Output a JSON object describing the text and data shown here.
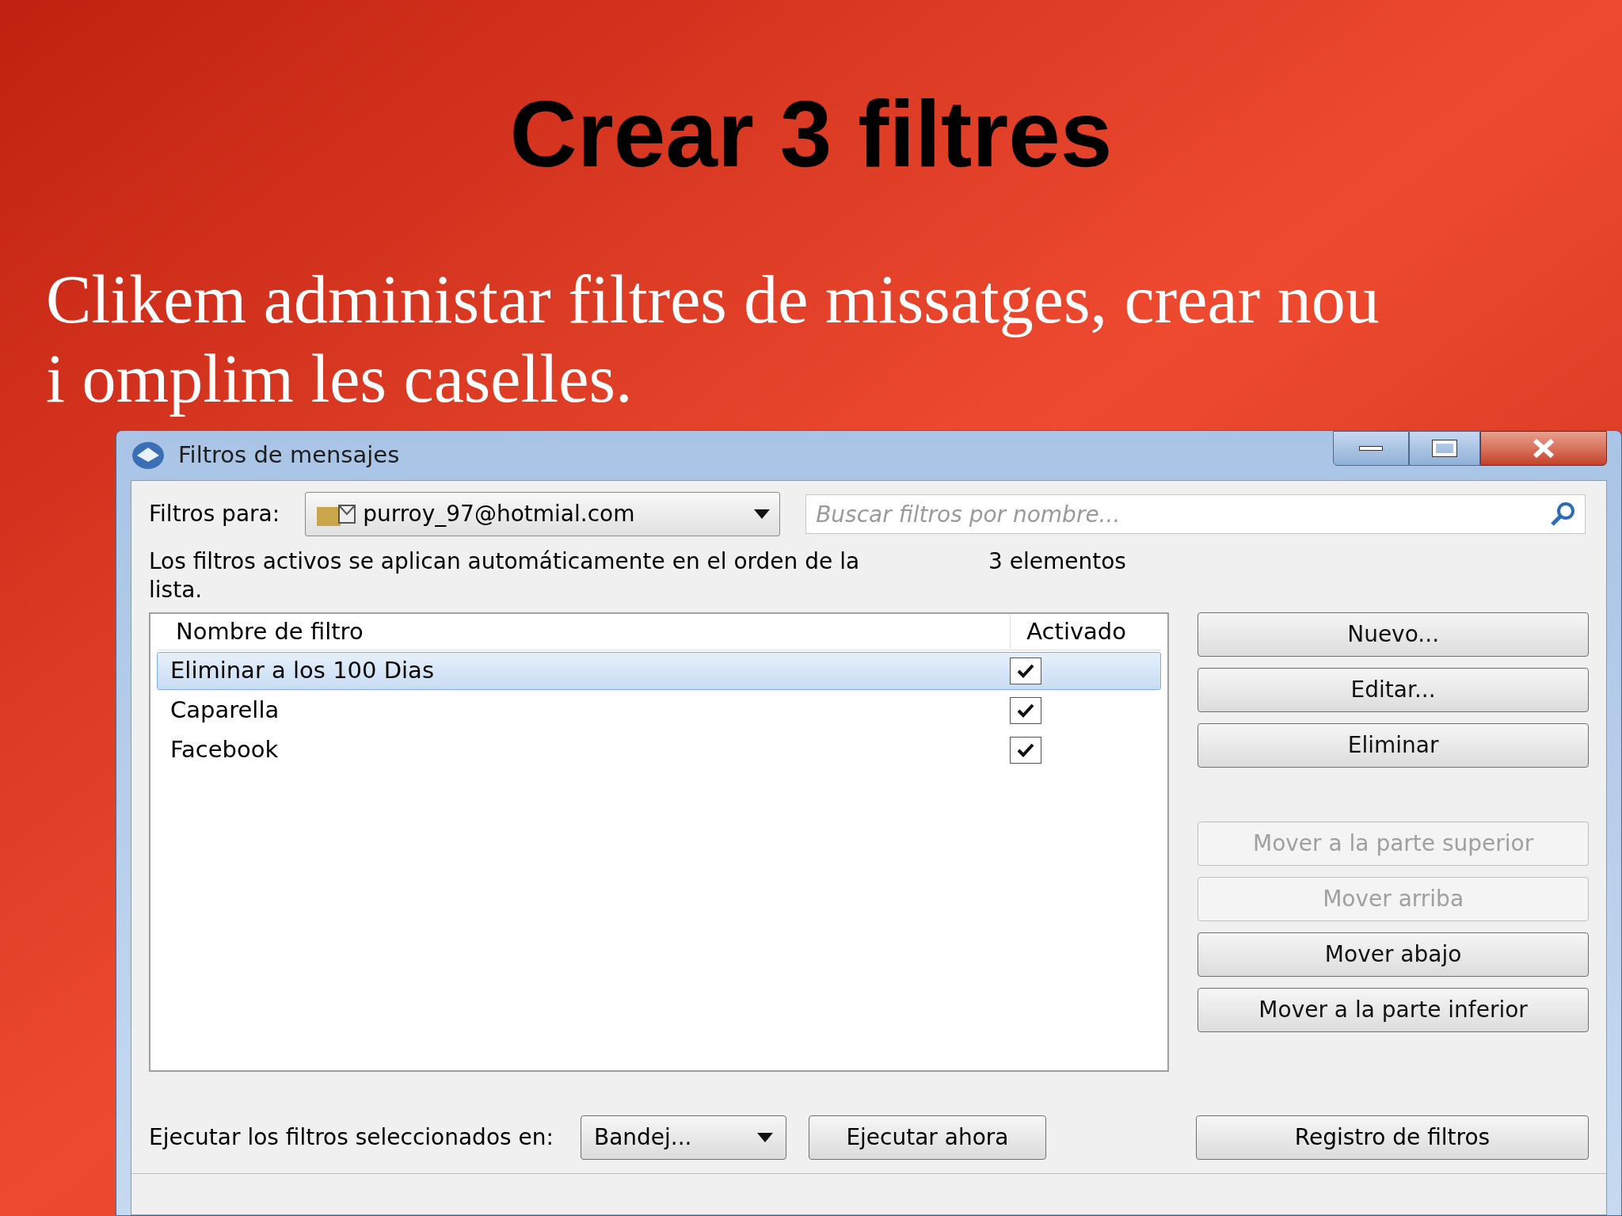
{
  "slide": {
    "title": "Crear 3 filtres",
    "text": "Clikem administar filtres de missatges, crear nou i omplim les caselles."
  },
  "dialog": {
    "title": "Filtros de mensajes",
    "filters_for_label": "Filtros para:",
    "account": "purroy_97@hotmial.com",
    "search": {
      "placeholder": "Buscar filtros por nombre..."
    },
    "description": "Los filtros activos se aplican automáticamente en el orden de la lista.",
    "count": "3 elementos",
    "columns": [
      "Nombre de filtro",
      "Activado"
    ],
    "rows": [
      {
        "name": "Eliminar a los 100 Dias",
        "checked": true,
        "selected": true
      },
      {
        "name": "Caparella",
        "checked": true,
        "selected": false
      },
      {
        "name": "Facebook",
        "checked": true,
        "selected": false
      }
    ],
    "button_groups": [
      [
        {
          "label": "Nuevo...",
          "disabled": false
        },
        {
          "label": "Editar...",
          "disabled": false
        },
        {
          "label": "Eliminar",
          "disabled": false
        }
      ],
      [
        {
          "label": "Mover a la parte superior",
          "disabled": true
        },
        {
          "label": "Mover arriba",
          "disabled": true
        },
        {
          "label": "Mover abajo",
          "disabled": false
        },
        {
          "label": "Mover a la parte inferior",
          "disabled": false
        }
      ]
    ],
    "run_label": "Ejecutar los filtros seleccionados en:",
    "folder": "Bandej...",
    "run_now": "Ejecutar ahora",
    "log_button": "Registro de filtros"
  }
}
